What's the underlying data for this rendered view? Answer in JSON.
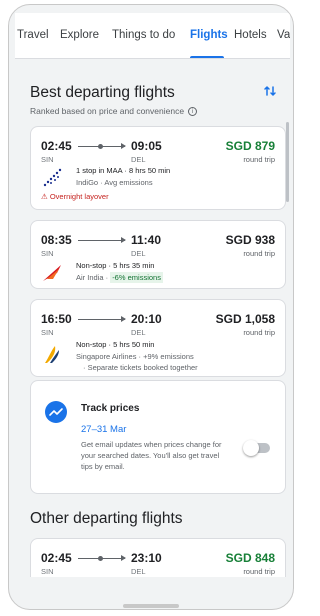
{
  "tabs": [
    "Travel",
    "Explore",
    "Things to do",
    "Flights",
    "Hotels",
    "Vaca"
  ],
  "active_tab": "Flights",
  "best": {
    "title": "Best departing flights",
    "subtitle": "Ranked based on price and convenience",
    "info_icon": "i"
  },
  "flights": [
    {
      "depart_time": "02:45",
      "arrive_time": "09:05",
      "from": "SIN",
      "to": "DEL",
      "price": "SGD 879",
      "trip_type": "round trip",
      "stops": "1 stop in MAA · 8 hrs 50 min",
      "airline": "IndiGo · Avg emissions",
      "warning": "Overnight layover"
    },
    {
      "depart_time": "08:35",
      "arrive_time": "11:40",
      "from": "SIN",
      "to": "DEL",
      "price": "SGD 938",
      "trip_type": "round trip",
      "stops": "Non-stop · 5 hrs 35 min",
      "airline": "Air India · ",
      "emissions": "-6% emissions"
    },
    {
      "depart_time": "16:50",
      "arrive_time": "20:10",
      "from": "SIN",
      "to": "DEL",
      "price": "SGD 1,058",
      "trip_type": "round trip",
      "stops": "Non-stop · 5 hrs 50 min",
      "airline": "Singapore Airlines · +9% emissions",
      "note": "· Separate tickets booked together"
    }
  ],
  "track": {
    "title": "Track prices",
    "dates": "27–31 Mar",
    "description": "Get email updates when prices change for your searched dates. You'll also get travel tips by email.",
    "enabled": false
  },
  "other": {
    "title": "Other departing flights",
    "flights": [
      {
        "depart_time": "02:45",
        "arrive_time": "23:10",
        "from": "SIN",
        "to": "DEL",
        "price": "SGD 848",
        "trip_type": "round trip"
      }
    ]
  },
  "colors": {
    "accent": "#1a73e8",
    "green_price": "#188038",
    "warning": "#c5221f"
  }
}
